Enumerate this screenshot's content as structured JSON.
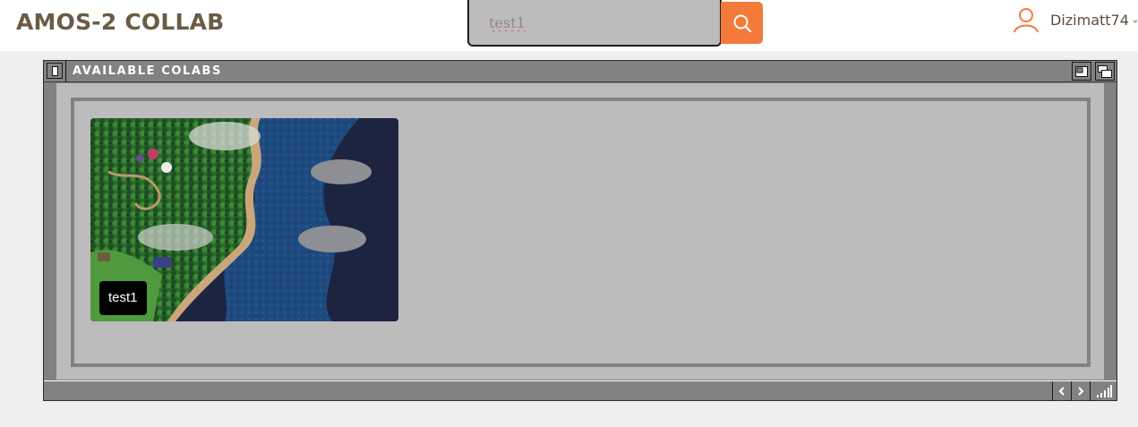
{
  "header": {
    "brand": "AMOS-2 COLLAB",
    "search": {
      "value": "test1",
      "button_icon": "search-icon"
    },
    "user": {
      "name": "Dizimatt74",
      "icon": "user-icon",
      "menu_icon": "chevron-down-icon"
    }
  },
  "window": {
    "title": "AVAILABLE COLABS",
    "controls": [
      "close-icon",
      "minimize-icon",
      "restore-icon"
    ],
    "status_controls": [
      "arrow-left-icon",
      "arrow-right-icon",
      "resize-grip-icon"
    ]
  },
  "colabs": [
    {
      "name": "test1",
      "thumbnail": "overworld-map-thumbnail"
    }
  ],
  "colors": {
    "accent": "#f47a3b",
    "brand": "#6b5b45",
    "window_chrome": "#828282",
    "panel": "#bdbbbc"
  }
}
